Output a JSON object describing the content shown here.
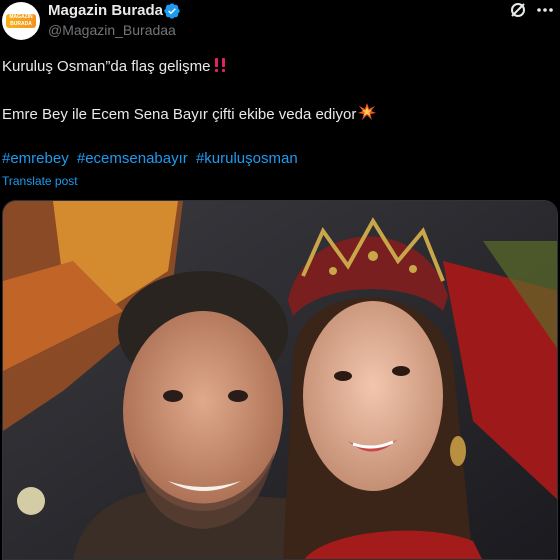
{
  "author": {
    "name": "Magazin Burada",
    "handle": "@Magazin_Buradaa",
    "avatar_text": "MAGAZIN BURADA",
    "verified": true,
    "brand_color": "#f7b21b"
  },
  "header_icons": [
    "grok-icon",
    "more-icon"
  ],
  "post": {
    "line1": "Kuruluş Osman”da flaş gelişme",
    "line1_emoji": "double-exclamation-icon",
    "line2": "Emre Bey ile Ecem Sena Bayır çifti ekibe veda ediyor",
    "line2_emoji": "collision-icon",
    "hashtags": [
      "#emrebey",
      "#ecemsenabayır",
      "#kuruluşosman"
    ],
    "translate_label": "Translate post"
  },
  "colors": {
    "background": "#000000",
    "text": "#e7e9ea",
    "secondary": "#71767b",
    "link": "#1d9bf0",
    "verified": "#1d9bf0"
  }
}
